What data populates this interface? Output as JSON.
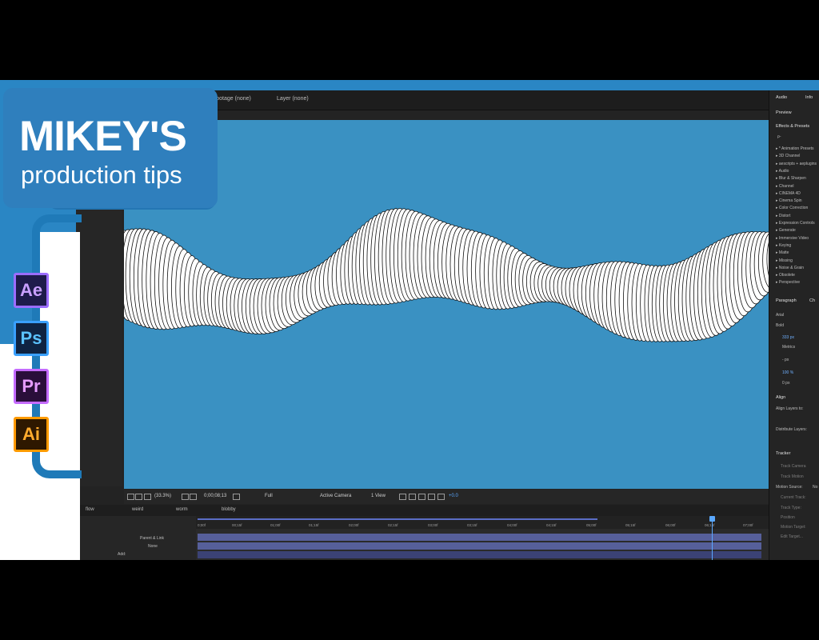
{
  "branding": {
    "title": "MIKEY'S",
    "subtitle": "production tips",
    "app_icons": [
      {
        "label": "Ae",
        "bg": "#1e1b4b",
        "fg": "#c9a0ff",
        "border": "#9b6dff"
      },
      {
        "label": "Ps",
        "bg": "#0f2342",
        "fg": "#5bc2ff",
        "border": "#39a0ff"
      },
      {
        "label": "Pr",
        "bg": "#2a0e3a",
        "fg": "#e59bff",
        "border": "#c46bff"
      },
      {
        "label": "Ai",
        "bg": "#2e1800",
        "fg": "#ffab2d",
        "border": "#ff9a00"
      }
    ]
  },
  "colors": {
    "frame_blue": "#1f7ab8",
    "viewer_blue": "#3a91c2",
    "panel_dark": "#232323"
  },
  "top_tabs": {
    "footage": "Footage (none)",
    "layer": "Layer (none)"
  },
  "viewer_toolbar": {
    "resolution": "(33.3%)",
    "timecode": "0;00;08;13",
    "quality": "Full",
    "camera": "Active Camera",
    "views": "1 View",
    "offset": "+0.0"
  },
  "timeline": {
    "tabs": [
      "flow",
      "weird",
      "worm",
      "blobby"
    ],
    "columns": [
      "Parent & Link",
      "None"
    ],
    "bottom_label": "Add:",
    "ruler": [
      "0;00f",
      "00;15f",
      "01;00f",
      "01;15f",
      "02;00f",
      "02;15f",
      "03;00f",
      "03;15f",
      "04;00f",
      "04;15f",
      "05;00f",
      "05;15f",
      "06;00f",
      "06;15f",
      "07;00f"
    ]
  },
  "right_panel": {
    "tabs": [
      "Audio",
      "Info"
    ],
    "preview": "Preview",
    "effects_title": "Effects & Presets",
    "search_glyph": "ρ-",
    "effects": [
      "* Animation Presets",
      "3D Channel",
      "aescripts + aeplugins",
      "Audio",
      "Blur & Sharpen",
      "Channel",
      "CINEMA 4D",
      "Cinema Spin",
      "Color Correction",
      "Distort",
      "Expression Controls",
      "Generate",
      "Immersive Video",
      "Keying",
      "Matte",
      "Missing",
      "Noise & Grain",
      "Obsolete",
      "Perspective"
    ],
    "paragraph_tabs": [
      "Paragraph",
      "Ch"
    ],
    "font": "Arial",
    "font_style": "Bold",
    "font_size": "333 px",
    "leading": "Metrics",
    "stroke": "- px",
    "scale": "100 %",
    "baseline": "0 px",
    "align_title": "Align",
    "align_to": "Align Layers to:",
    "distribute": "Distribute Layers:",
    "tracker_title": "Tracker",
    "tracker_items": [
      "Track Camera",
      "Track Motion",
      "Motion Source:",
      "Current Track:",
      "Track Type:",
      "Position",
      "Motion Target:",
      "Edit Target..."
    ],
    "motion_source_value": "No"
  }
}
